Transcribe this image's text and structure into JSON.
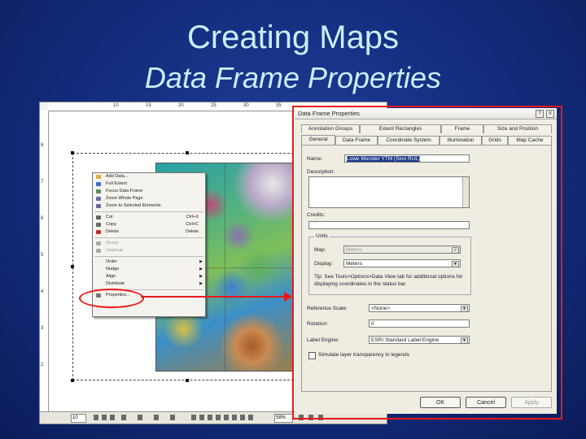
{
  "slide": {
    "title": "Creating Maps",
    "subtitle": "Data Frame Properties"
  },
  "arcmap": {
    "ruler_ticks": [
      "10",
      "15",
      "20",
      "25",
      "30",
      "35"
    ],
    "ruler_left_ticks": [
      "8",
      "7",
      "6",
      "5",
      "4",
      "3",
      "2"
    ],
    "context_menu": [
      {
        "label": "Add Data...",
        "shortcut": "",
        "submenu": false,
        "disabled": false,
        "icon": "add-data-icon"
      },
      {
        "label": "Full Extent",
        "shortcut": "",
        "submenu": false,
        "disabled": false,
        "icon": "full-extent-icon"
      },
      {
        "label": "Focus Data Frame",
        "shortcut": "",
        "submenu": false,
        "disabled": false,
        "icon": "focus-icon"
      },
      {
        "label": "Zoom Whole Page",
        "shortcut": "",
        "submenu": false,
        "disabled": false,
        "icon": "zoom-page-icon"
      },
      {
        "label": "Zoom to Selected Elements",
        "shortcut": "",
        "submenu": false,
        "disabled": false,
        "icon": "zoom-selected-icon"
      },
      {
        "label": "Cut",
        "shortcut": "Ctrl+X",
        "submenu": false,
        "disabled": false,
        "icon": "cut-icon"
      },
      {
        "label": "Copy",
        "shortcut": "Ctrl+C",
        "submenu": false,
        "disabled": false,
        "icon": "copy-icon"
      },
      {
        "label": "Delete",
        "shortcut": "Delete",
        "submenu": false,
        "disabled": false,
        "icon": "delete-icon"
      },
      {
        "label": "Group",
        "shortcut": "",
        "submenu": false,
        "disabled": true,
        "icon": "group-icon"
      },
      {
        "label": "Ungroup",
        "shortcut": "",
        "submenu": false,
        "disabled": true,
        "icon": "ungroup-icon"
      },
      {
        "label": "Order",
        "shortcut": "",
        "submenu": true,
        "disabled": false,
        "icon": ""
      },
      {
        "label": "Nudge",
        "shortcut": "",
        "submenu": true,
        "disabled": false,
        "icon": ""
      },
      {
        "label": "Align",
        "shortcut": "",
        "submenu": true,
        "disabled": false,
        "icon": ""
      },
      {
        "label": "Distribute",
        "shortcut": "",
        "submenu": true,
        "disabled": false,
        "icon": ""
      },
      {
        "label": "Properties...",
        "shortcut": "",
        "submenu": false,
        "disabled": false,
        "icon": "properties-icon"
      }
    ],
    "toolbar": {
      "font_size": "10",
      "zoom": "58%"
    }
  },
  "dialog": {
    "title": "Data Frame Properties",
    "help_glyph": "?",
    "close_glyph": "X",
    "tabs_row1": [
      "Annotation Groups",
      "Extent Rectangles",
      "Frame",
      "Size and Position"
    ],
    "tabs_row2": [
      "General",
      "Data Frame",
      "Coordinate System",
      "Illumination",
      "Grids",
      "Map Cache"
    ],
    "active_tab": "General",
    "name_label": "Name:",
    "name_value": "Lowe Monster YTM (Sion RUL)",
    "description_label": "Description:",
    "credits_label": "Credits:",
    "units_group": "Units",
    "map_units_label": "Map:",
    "map_units_value": "Meters",
    "display_units_label": "Display:",
    "display_units_value": "Meters",
    "tip_text": "Tip: See Tools>Options>Data View tab for additional options for displaying coordinates in the status bar",
    "reference_scale_label": "Reference Scale:",
    "reference_scale_value": "<None>",
    "rotation_label": "Rotation:",
    "rotation_value": "0",
    "label_engine_label": "Label Engine:",
    "label_engine_value": "ESRI Standard Label Engine",
    "simulate_label": "Simulate layer transparency in legends",
    "simulate_checked": false,
    "buttons": {
      "ok": "OK",
      "cancel": "Cancel",
      "apply": "Apply"
    }
  },
  "colors": {
    "highlight": "#e81818",
    "title_text": "#c9efff",
    "background": "#132c7c"
  }
}
